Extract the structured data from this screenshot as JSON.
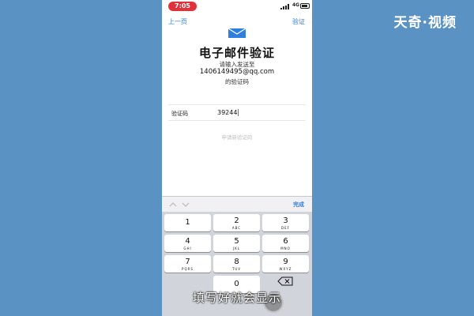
{
  "watermark": "天奇·视频",
  "status_bar": {
    "time": "7:05",
    "network": "4G"
  },
  "nav": {
    "back_label": "上一页",
    "next_label": "验证"
  },
  "page": {
    "title": "电子邮件验证",
    "desc_line1": "请输入发送至",
    "email": "1406149495@qq.com",
    "desc_line2": "的验证码"
  },
  "code_field": {
    "label": "验证码",
    "value": "39244"
  },
  "resend_label": "申请新验证码",
  "keyboard": {
    "done_label": "完成",
    "keys": [
      {
        "digit": "1",
        "letters": ""
      },
      {
        "digit": "2",
        "letters": "ABC"
      },
      {
        "digit": "3",
        "letters": "DEF"
      },
      {
        "digit": "4",
        "letters": "GHI"
      },
      {
        "digit": "5",
        "letters": "JKL"
      },
      {
        "digit": "6",
        "letters": "MNO"
      },
      {
        "digit": "7",
        "letters": "PQRS"
      },
      {
        "digit": "8",
        "letters": "TUV"
      },
      {
        "digit": "9",
        "letters": "WXYZ"
      },
      {
        "digit": "0",
        "letters": ""
      }
    ]
  },
  "subtitle": "填写好就会显示",
  "colors": {
    "background": "#5a92c4",
    "accent_blue": "#2f7fe0",
    "time_pill": "#e0323a",
    "keyboard_bg": "#d1d4da"
  },
  "icons": [
    "mail-icon",
    "signal-icon",
    "battery-icon",
    "chevron-up-icon",
    "chevron-down-icon",
    "delete-icon"
  ]
}
